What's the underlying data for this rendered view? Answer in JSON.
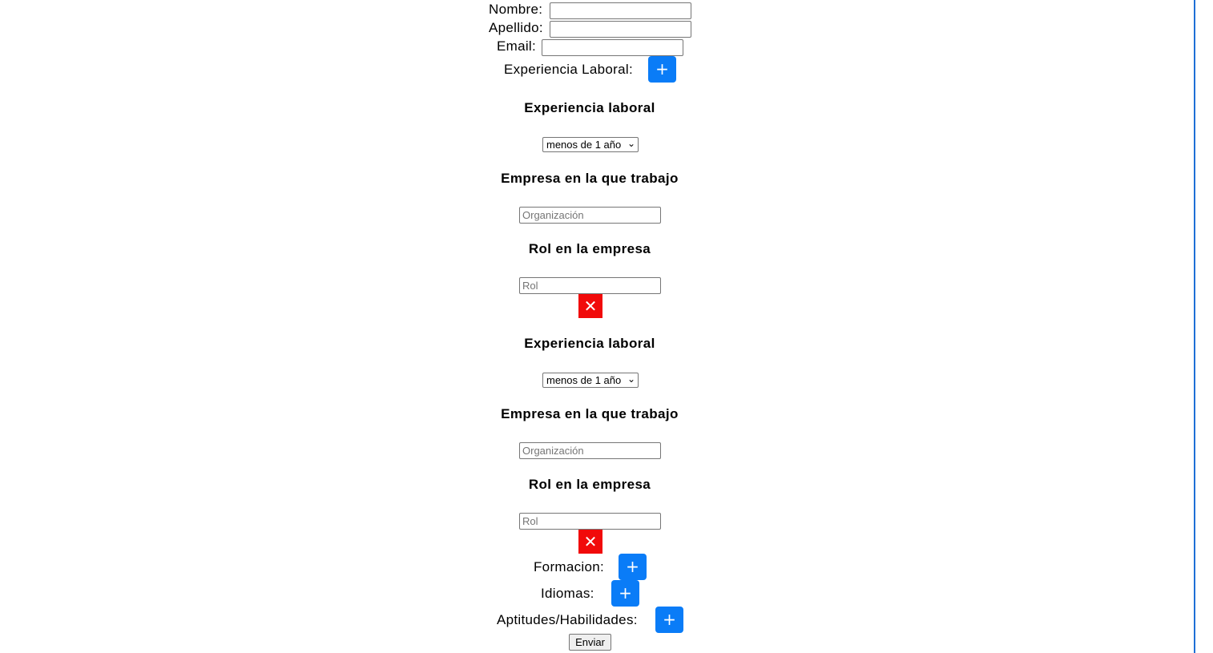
{
  "form": {
    "nombre_label": "Nombre:",
    "nombre_value": "",
    "apellido_label": "Apellido:",
    "apellido_value": "",
    "email_label": "Email:",
    "email_value": "",
    "experiencia_label": "Experiencia Laboral:",
    "add_symbol": "+",
    "formacion_label": "Formacion:",
    "idiomas_label": "Idiomas:",
    "aptitudes_label": "Aptitudes/Habilidades:",
    "submit_label": "Enviar"
  },
  "experience_entries": [
    {
      "experience_heading": "Experiencia laboral",
      "years_selected": "menos de 1 año",
      "company_heading": "Empresa en la que trabajo",
      "company_placeholder": "Organización",
      "company_value": "",
      "role_heading": "Rol en la empresa",
      "role_placeholder": "Rol",
      "role_value": "",
      "remove_symbol": "✕"
    },
    {
      "experience_heading": "Experiencia laboral",
      "years_selected": "menos de 1 año",
      "company_heading": "Empresa en la que trabajo",
      "company_placeholder": "Organización",
      "company_value": "",
      "role_heading": "Rol en la empresa",
      "role_placeholder": "Rol",
      "role_value": "",
      "remove_symbol": "✕"
    }
  ],
  "icons": {
    "add": "plus-icon",
    "remove": "close-icon",
    "select": "chevron-down-icon"
  },
  "colors": {
    "add_button": "#0a7cf7",
    "remove_button": "#f10a0a",
    "page_border": "#1e6fd6"
  }
}
